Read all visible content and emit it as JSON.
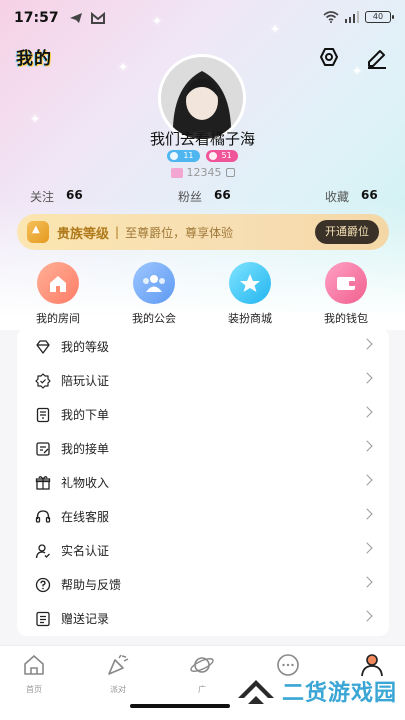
{
  "status_bar": {
    "time": "17:57",
    "battery": "40"
  },
  "header": {
    "title": "我的"
  },
  "profile": {
    "nickname": "我们去看橘子海",
    "badge_level_1": "11",
    "badge_level_2": "51",
    "user_id": "12345"
  },
  "stats": [
    {
      "label": "关注",
      "value": "66"
    },
    {
      "label": "粉丝",
      "value": "66"
    },
    {
      "label": "收藏",
      "value": "66"
    }
  ],
  "vip": {
    "title": "贵族等级",
    "separator": "|",
    "desc": "至尊爵位，尊享体验",
    "button": "开通爵位"
  },
  "quick_actions": [
    {
      "label": "我的房间",
      "icon": "home-icon"
    },
    {
      "label": "我的公会",
      "icon": "group-icon"
    },
    {
      "label": "装扮商城",
      "icon": "star-icon"
    },
    {
      "label": "我的钱包",
      "icon": "wallet-icon"
    }
  ],
  "menu": [
    {
      "label": "我的等级",
      "icon": "diamond-icon"
    },
    {
      "label": "陪玩认证",
      "icon": "badge-check-icon"
    },
    {
      "label": "我的下单",
      "icon": "order-icon"
    },
    {
      "label": "我的接单",
      "icon": "receive-order-icon"
    },
    {
      "label": "礼物收入",
      "icon": "gift-icon"
    },
    {
      "label": "在线客服",
      "icon": "headset-icon"
    },
    {
      "label": "实名认证",
      "icon": "user-verify-icon"
    },
    {
      "label": "帮助与反馈",
      "icon": "help-icon"
    },
    {
      "label": "赠送记录",
      "icon": "record-icon"
    }
  ],
  "tabs": [
    {
      "label": "首页"
    },
    {
      "label": "派对"
    },
    {
      "label": "广"
    },
    {
      "label": ""
    },
    {
      "label": ""
    }
  ],
  "watermark": {
    "text": "二货游戏园"
  },
  "colors": {
    "accent_gold": "#b07a1a",
    "vip_btn_bg": "#3a3128",
    "brand_blue": "#3aa6d6"
  }
}
